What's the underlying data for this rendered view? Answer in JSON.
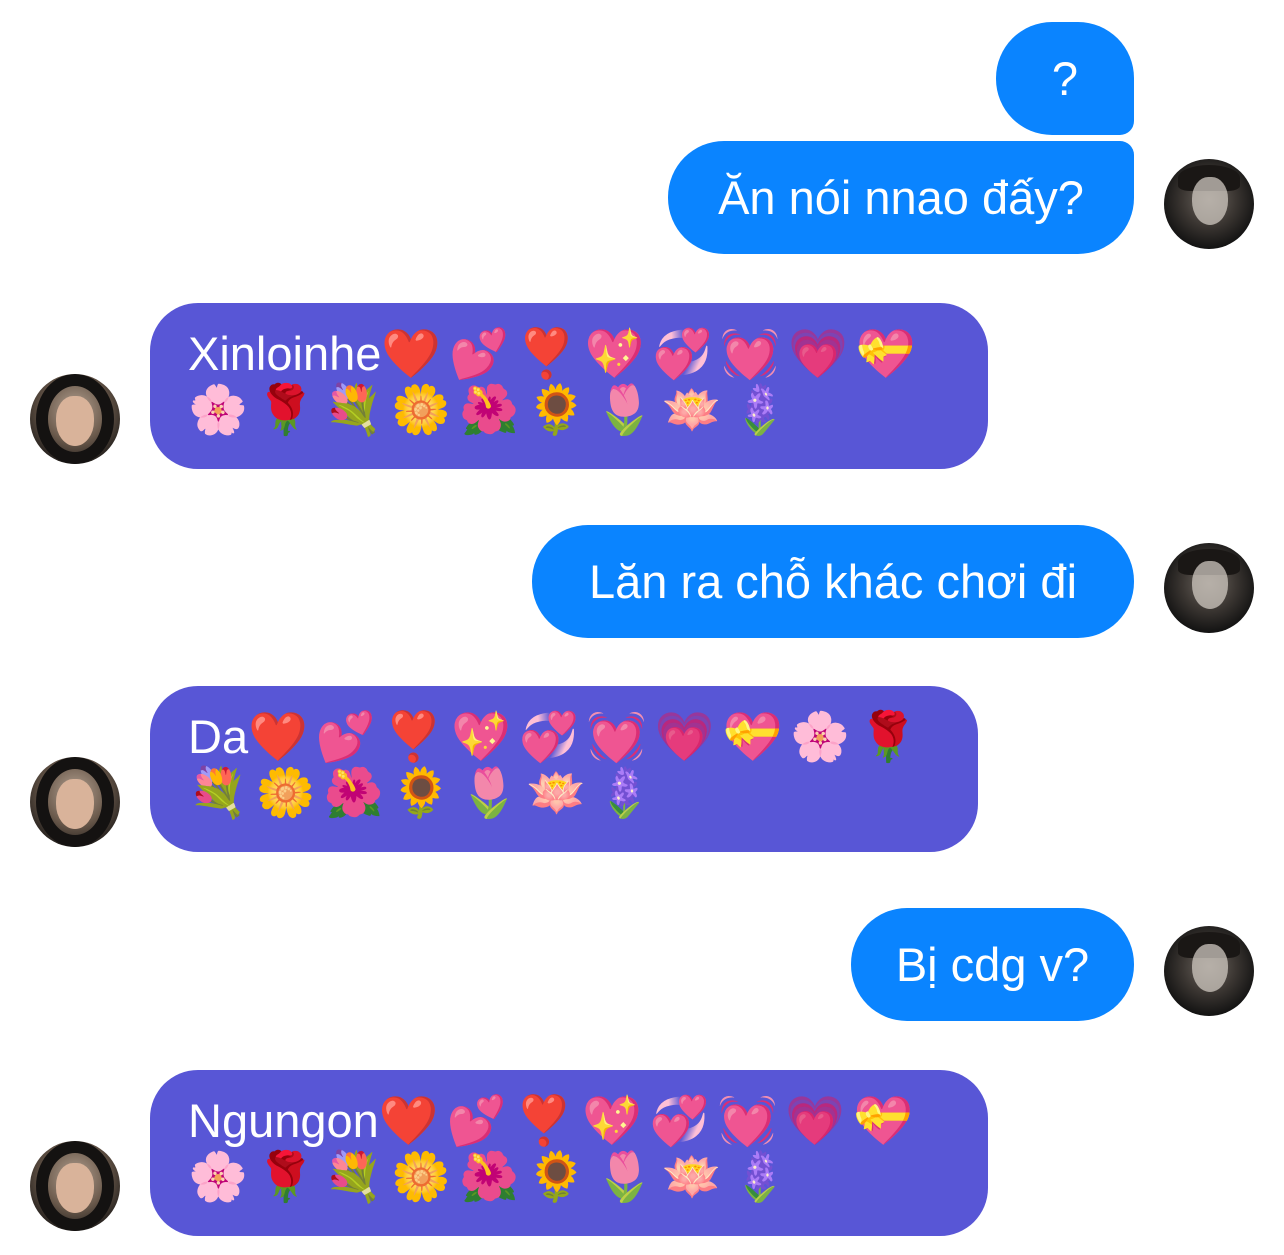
{
  "messages": [
    {
      "side": "out",
      "text": "?"
    },
    {
      "side": "out",
      "text": "Ăn nói nnao đấy?"
    },
    {
      "side": "in",
      "text": "Xinloinhe",
      "emoji_line1": "❤️💕❣️💖💞💓💗💝",
      "emoji_line2": "🌸🌹💐🌼🌺🌻🌷🪷🪻"
    },
    {
      "side": "out",
      "text": "Lăn ra chỗ khác chơi đi"
    },
    {
      "side": "in",
      "text": "Da",
      "emoji_line1": "❤️💕❣️💖💞💓💗💝🌸🌹",
      "emoji_line2": "💐🌼🌺🌻🌷🪷🪻"
    },
    {
      "side": "out",
      "text": "Bị cdg v?"
    },
    {
      "side": "in",
      "text": "Ngungon",
      "emoji_line1": "❤️💕❣️💖💞💓💗💝",
      "emoji_line2": "🌸🌹💐🌼🌺🌻🌷🪷🪻"
    }
  ],
  "colors": {
    "outgoing_bubble": "#0a84ff",
    "incoming_bubble": "#5856d6",
    "background": "#ffffff",
    "text": "#ffffff"
  },
  "avatars": {
    "me": "profile-photo",
    "them": "profile-photo"
  }
}
